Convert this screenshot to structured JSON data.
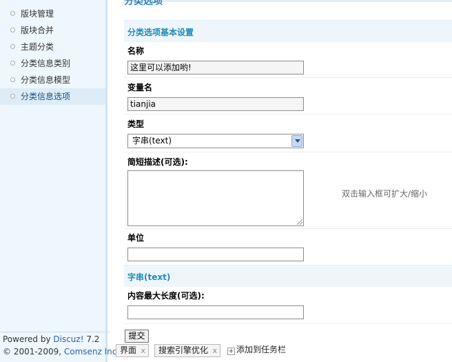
{
  "sidebar": {
    "items": [
      {
        "label": "版块管理",
        "active": false
      },
      {
        "label": "版块合并",
        "active": false
      },
      {
        "label": "主题分类",
        "active": false
      },
      {
        "label": "分类信息类别",
        "active": false
      },
      {
        "label": "分类信息模型",
        "active": false
      },
      {
        "label": "分类信息选项",
        "active": true
      }
    ],
    "footer": {
      "powered_prefix": "Powered by ",
      "powered_link": "Discuz!",
      "version": " 7.2",
      "copyright_prefix": "© 2001-2009, ",
      "copyright_link": "Comsenz Inc."
    }
  },
  "main": {
    "page_title_cut": "分类选项",
    "section_basic": "分类选项基本设置",
    "fields": {
      "name_label": "名称",
      "name_value": "这里可以添加哟!",
      "var_label": "变量名",
      "var_value": "tianjia",
      "type_label": "类型",
      "type_value": "字串(text)",
      "desc_label": "简短描述(可选):",
      "desc_hint": "双击输入框可扩大/缩小",
      "unit_label": "单位",
      "unit_value": ""
    },
    "section_text": "字串(text)",
    "maxlen_label": "内容最大长度(可选):",
    "maxlen_value": "",
    "submit_label": "提交"
  },
  "taskbar": {
    "items": [
      {
        "label": "界面",
        "close": "x"
      },
      {
        "label": "搜索引擎优化",
        "close": "x"
      }
    ],
    "add_label": "添加到任务栏",
    "add_icon": "plus-icon"
  }
}
